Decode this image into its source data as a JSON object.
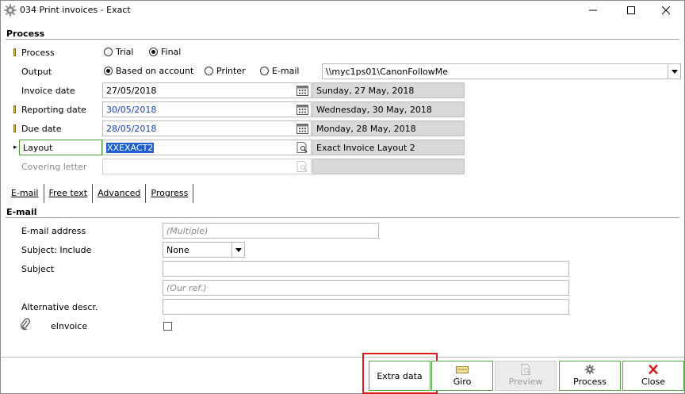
{
  "window": {
    "title": "034 Print invoices - Exact"
  },
  "process_section": {
    "title": "Process",
    "process_label": "Process",
    "process_options": [
      {
        "label": "Trial",
        "checked": false
      },
      {
        "label": "Final",
        "checked": true
      }
    ],
    "output_label": "Output",
    "output_options": [
      {
        "label": "Based on account",
        "checked": true
      },
      {
        "label": "Printer",
        "checked": false
      },
      {
        "label": "E-mail",
        "checked": false
      }
    ],
    "printer_value": "\\\\myc1ps01\\CanonFollowMe",
    "invoice_date": {
      "label": "Invoice date",
      "value": "27/05/2018",
      "description": "Sunday, 27 May, 2018"
    },
    "reporting_date": {
      "label": "Reporting date",
      "value": "30/05/2018",
      "description": "Wednesday, 30 May, 2018"
    },
    "due_date": {
      "label": "Due date",
      "value": "28/05/2018",
      "description": "Monday, 28 May, 2018"
    },
    "layout": {
      "label": "Layout",
      "value": "XXEXACT2",
      "description": "Exact Invoice Layout 2"
    },
    "covering_letter": {
      "label": "Covering letter",
      "value": "",
      "description": ""
    }
  },
  "tabs": [
    {
      "label": "E-mail"
    },
    {
      "label": "Free text"
    },
    {
      "label": "Advanced"
    },
    {
      "label": "Progress"
    }
  ],
  "email_section": {
    "title": "E-mail",
    "address_label": "E-mail address",
    "address_placeholder": "(Multiple)",
    "subject_include_label": "Subject: Include",
    "subject_include_value": "None",
    "subject_label": "Subject",
    "subject_value": "",
    "subject_ref_placeholder": "(Our ref.)",
    "alt_descr_label": "Alternative descr.",
    "alt_descr_value": "",
    "einvoice_label": "eInvoice",
    "einvoice_checked": false
  },
  "footer": {
    "extra_data": "Extra data",
    "giro": "Giro",
    "preview": "Preview",
    "process": "Process",
    "close": "Close"
  },
  "colors": {
    "accent_green": "#5aa34d",
    "highlight_red": "#d81b1b",
    "date_blue": "#1c3fc4",
    "selection_blue": "#1f5fd0"
  }
}
